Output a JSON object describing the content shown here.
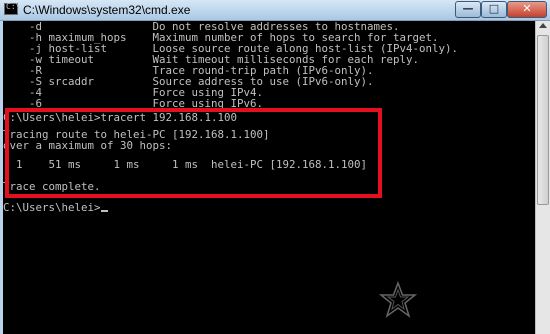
{
  "window": {
    "title": "C:\\Windows\\system32\\cmd.exe",
    "icon_label": "C:\\",
    "controls": {
      "minimize": "—",
      "maximize": "□",
      "close": "✕"
    }
  },
  "console": {
    "lines": [
      "    -d                 Do not resolve addresses to hostnames.",
      "    -h maximum_hops    Maximum number of hops to search for target.",
      "    -j host-list       Loose source route along host-list (IPv4-only).",
      "    -w timeout         Wait timeout milliseconds for each reply.",
      "    -R                 Trace round-trip path (IPv6-only).",
      "    -S srcaddr         Source address to use (IPv6-only).",
      "    -4                 Force using IPv4.",
      "    -6                 Force using IPv6.",
      "",
      "C:\\Users\\helei>tracert 192.168.1.100",
      "",
      "Tracing route to helei-PC [192.168.1.100]",
      "over a maximum of 30 hops:",
      "",
      "  1    51 ms     1 ms     1 ms  helei-PC [192.168.1.100]",
      "",
      "Trace complete.",
      "",
      "C:\\Users\\helei>"
    ]
  },
  "colors": {
    "console_background": "#000000",
    "console_text": "#c0c0c0",
    "highlight_border": "#e5101d"
  },
  "icons": {
    "watermark": "star-watermark-icon"
  }
}
